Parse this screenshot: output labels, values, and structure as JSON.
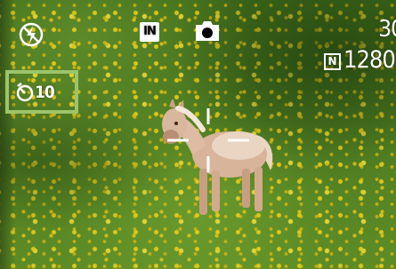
{
  "hud": {
    "flash_mode_icon": "flash-off-icon",
    "memory_badge": "IN",
    "capture_mode_icon": "camera-icon",
    "shots_remaining": "30",
    "quality_badge": "N",
    "resolution": "1280",
    "self_timer_icon": "self-timer-icon",
    "self_timer_value": "10"
  },
  "colors": {
    "hud_text": "#ffffff",
    "timer_highlight": "#9cc46b"
  }
}
